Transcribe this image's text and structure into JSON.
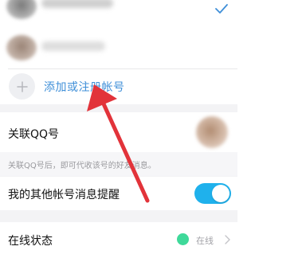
{
  "accounts": {
    "add_label": "添加或注册帐号",
    "accent_color": "#3f8fd8"
  },
  "linked_qq": {
    "title": "关联QQ号",
    "description": "关联QQ号后，即可代收该号的好友消息。"
  },
  "other_accounts_reminder": {
    "label": "我的其他帐号消息提醒",
    "enabled": true,
    "toggle_color": "#1fb1ec"
  },
  "online_status": {
    "label": "在线状态",
    "value": "在线",
    "dot_color": "#3fd99a"
  },
  "annotation": {
    "arrow_color": "#e2333a"
  },
  "icons": [
    "check-icon",
    "plus-icon",
    "chevron-right-icon"
  ]
}
